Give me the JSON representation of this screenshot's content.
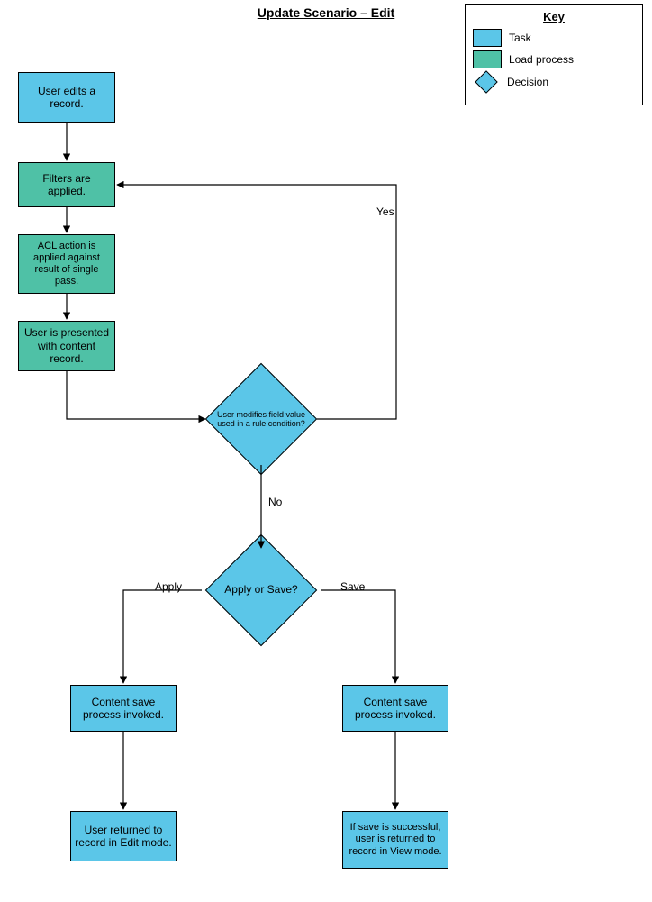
{
  "title": "Update Scenario – Edit",
  "key": {
    "title": "Key",
    "items": [
      {
        "label": "Task"
      },
      {
        "label": "Load process"
      },
      {
        "label": "Decision"
      }
    ]
  },
  "nodes": {
    "n1": "User edits a record.",
    "n2": "Filters are applied.",
    "n3": "ACL action is applied against result of single pass.",
    "n4": "User is presented with content record.",
    "d1": "User modifies field value used in a rule condition?",
    "d2": "Apply or Save?",
    "n5a": "Content save process invoked.",
    "n5b": "Content save process invoked.",
    "n6a": "User returned to record in Edit mode.",
    "n6b": "If save is successful, user is returned to record in View mode."
  },
  "edges": {
    "yes": "Yes",
    "no": "No",
    "apply": "Apply",
    "save": "Save"
  },
  "colors": {
    "task": "#5bc6e8",
    "process": "#4fc1a6"
  }
}
